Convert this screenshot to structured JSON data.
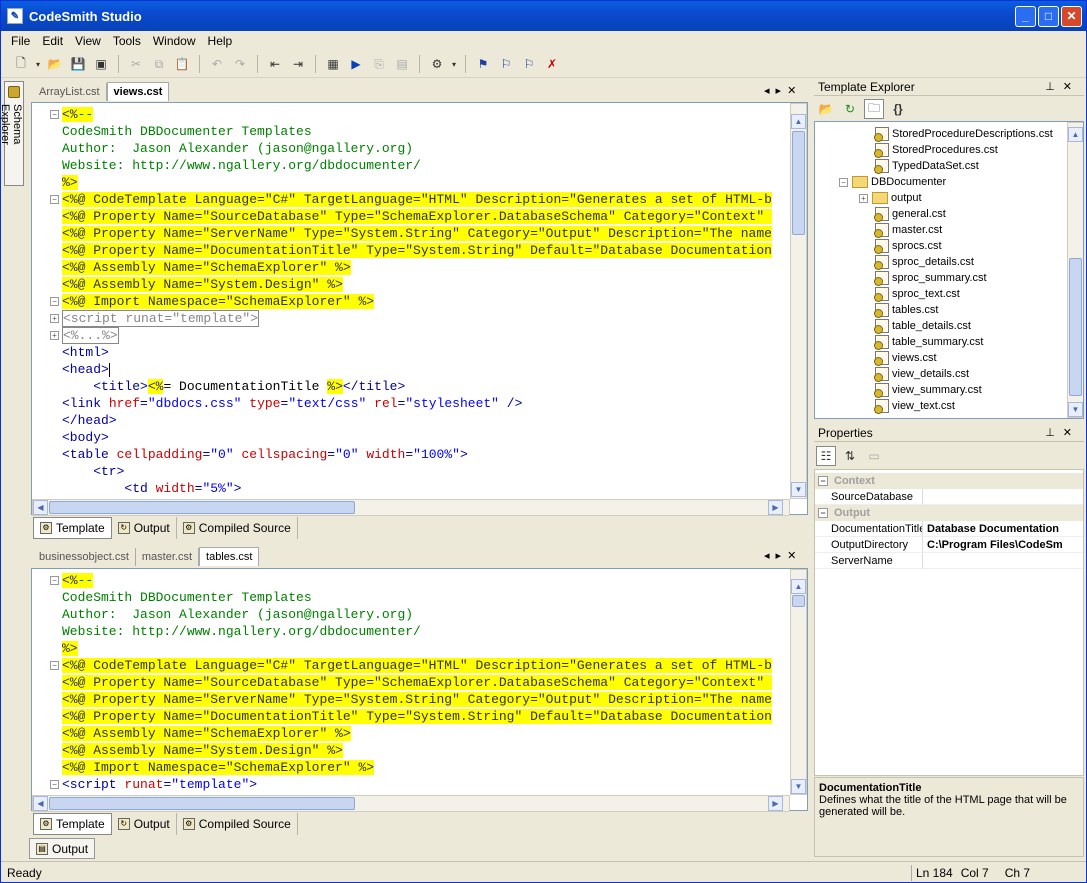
{
  "app": {
    "title": "CodeSmith Studio"
  },
  "menu": [
    "File",
    "Edit",
    "View",
    "Tools",
    "Window",
    "Help"
  ],
  "side_tab": {
    "label": "Schema Explorer"
  },
  "editor_top": {
    "tabs": [
      {
        "label": "ArrayList.cst",
        "active": false
      },
      {
        "label": "views.cst",
        "active": true
      }
    ],
    "lines": [
      {
        "fold": "-",
        "hl": true,
        "segs": [
          [
            "dir",
            "<%"
          ],
          [
            "com",
            "--"
          ]
        ]
      },
      {
        "fold": "",
        "hl": false,
        "segs": [
          [
            "com",
            "CodeSmith DBDocumenter Templates"
          ]
        ]
      },
      {
        "fold": "",
        "hl": false,
        "segs": [
          [
            "com",
            "Author:  Jason Alexander (jason@ngallery.org)"
          ]
        ]
      },
      {
        "fold": "",
        "hl": false,
        "segs": [
          [
            "com",
            "Website: http://www.ngallery.org/dbdocumenter/"
          ]
        ]
      },
      {
        "fold": "",
        "hl": true,
        "segs": [
          [
            "dir",
            "%>"
          ]
        ]
      },
      {
        "fold": "-",
        "hl": true,
        "segs": [
          [
            "dir",
            "<%@ CodeTemplate Language=\"C#\" TargetLanguage=\"HTML\" Description=\"Generates a set of HTML-b"
          ]
        ]
      },
      {
        "fold": "",
        "hl": true,
        "segs": [
          [
            "dir",
            "<%@ Property Name=\"SourceDatabase\" Type=\"SchemaExplorer.DatabaseSchema\" Category=\"Context\" "
          ]
        ]
      },
      {
        "fold": "",
        "hl": true,
        "segs": [
          [
            "dir",
            "<%@ Property Name=\"ServerName\" Type=\"System.String\" Category=\"Output\" Description=\"The name"
          ]
        ]
      },
      {
        "fold": "",
        "hl": true,
        "segs": [
          [
            "dir",
            "<%@ Property Name=\"DocumentationTitle\" Type=\"System.String\" Default=\"Database Documentation"
          ]
        ]
      },
      {
        "fold": "",
        "hl": true,
        "segs": [
          [
            "dir",
            "<%@ Assembly Name=\"SchemaExplorer\" %>"
          ]
        ]
      },
      {
        "fold": "",
        "hl": true,
        "segs": [
          [
            "dir",
            "<%@ Assembly Name=\"System.Design\" %>"
          ]
        ]
      },
      {
        "fold": "-",
        "hl": true,
        "segs": [
          [
            "dir",
            "<%@ Import Namespace=\"SchemaExplorer\" %>"
          ]
        ]
      },
      {
        "fold": "+",
        "hl": false,
        "segs": [
          [
            "box",
            "<script runat=\"template\">"
          ]
        ]
      },
      {
        "fold": "+",
        "hl": false,
        "segs": [
          [
            "box",
            "<%...%>"
          ]
        ]
      },
      {
        "fold": "",
        "hl": false,
        "segs": [
          [
            "tag",
            "<html>"
          ]
        ]
      },
      {
        "fold": "",
        "hl": false,
        "segs": [
          [
            "tag",
            "<head>"
          ]
        ]
      },
      {
        "fold": "",
        "hl": false,
        "segs": [
          [
            "tag",
            "    <title>"
          ],
          [
            "hldir",
            "<%"
          ],
          [
            "plain",
            "= DocumentationTitle "
          ],
          [
            "hldir",
            "%>"
          ],
          [
            "tag",
            "</title>"
          ]
        ]
      },
      {
        "fold": "",
        "hl": false,
        "segs": [
          [
            "tag",
            "<link "
          ],
          [
            "att",
            "href"
          ],
          [
            "tag",
            "="
          ],
          [
            "str",
            "\"dbdocs.css\""
          ],
          [
            "tag",
            " "
          ],
          [
            "att",
            "type"
          ],
          [
            "tag",
            "="
          ],
          [
            "str",
            "\"text/css\""
          ],
          [
            "tag",
            " "
          ],
          [
            "att",
            "rel"
          ],
          [
            "tag",
            "="
          ],
          [
            "str",
            "\"stylesheet\""
          ],
          [
            "tag",
            " />"
          ]
        ]
      },
      {
        "fold": "",
        "hl": false,
        "segs": [
          [
            "tag",
            "</head>"
          ]
        ]
      },
      {
        "fold": "",
        "hl": false,
        "segs": [
          [
            "tag",
            "<body>"
          ]
        ]
      },
      {
        "fold": "",
        "hl": false,
        "segs": [
          [
            "tag",
            "<table "
          ],
          [
            "att",
            "cellpadding"
          ],
          [
            "tag",
            "="
          ],
          [
            "str",
            "\"0\""
          ],
          [
            "tag",
            " "
          ],
          [
            "att",
            "cellspacing"
          ],
          [
            "tag",
            "="
          ],
          [
            "str",
            "\"0\""
          ],
          [
            "tag",
            " "
          ],
          [
            "att",
            "width"
          ],
          [
            "tag",
            "="
          ],
          [
            "str",
            "\"100%\""
          ],
          [
            "tag",
            ">"
          ]
        ]
      },
      {
        "fold": "",
        "hl": false,
        "segs": [
          [
            "tag",
            "    <tr>"
          ]
        ]
      },
      {
        "fold": "",
        "hl": false,
        "segs": [
          [
            "tag",
            "        <td "
          ],
          [
            "att",
            "width"
          ],
          [
            "tag",
            "="
          ],
          [
            "str",
            "\"5%\""
          ],
          [
            "tag",
            ">"
          ]
        ]
      }
    ]
  },
  "editor_bottom": {
    "tabs": [
      {
        "label": "businessobject.cst",
        "active": false
      },
      {
        "label": "master.cst",
        "active": false
      },
      {
        "label": "tables.cst",
        "active": true
      }
    ],
    "lines": [
      {
        "fold": "-",
        "hl": true,
        "segs": [
          [
            "dir",
            "<%"
          ],
          [
            "com",
            "--"
          ]
        ]
      },
      {
        "fold": "",
        "hl": false,
        "segs": [
          [
            "com",
            "CodeSmith DBDocumenter Templates"
          ]
        ]
      },
      {
        "fold": "",
        "hl": false,
        "segs": [
          [
            "com",
            "Author:  Jason Alexander (jason@ngallery.org)"
          ]
        ]
      },
      {
        "fold": "",
        "hl": false,
        "segs": [
          [
            "com",
            "Website: http://www.ngallery.org/dbdocumenter/"
          ]
        ]
      },
      {
        "fold": "",
        "hl": true,
        "segs": [
          [
            "dir",
            "%>"
          ]
        ]
      },
      {
        "fold": "-",
        "hl": true,
        "segs": [
          [
            "dir",
            "<%@ CodeTemplate Language=\"C#\" TargetLanguage=\"HTML\" Description=\"Generates a set of HTML-b"
          ]
        ]
      },
      {
        "fold": "",
        "hl": true,
        "segs": [
          [
            "dir",
            "<%@ Property Name=\"SourceDatabase\" Type=\"SchemaExplorer.DatabaseSchema\" Category=\"Context\" "
          ]
        ]
      },
      {
        "fold": "",
        "hl": true,
        "segs": [
          [
            "dir",
            "<%@ Property Name=\"ServerName\" Type=\"System.String\" Category=\"Output\" Description=\"The name"
          ]
        ]
      },
      {
        "fold": "",
        "hl": true,
        "segs": [
          [
            "dir",
            "<%@ Property Name=\"DocumentationTitle\" Type=\"System.String\" Default=\"Database Documentation"
          ]
        ]
      },
      {
        "fold": "",
        "hl": true,
        "segs": [
          [
            "dir",
            "<%@ Assembly Name=\"SchemaExplorer\" %>"
          ]
        ]
      },
      {
        "fold": "",
        "hl": true,
        "segs": [
          [
            "dir",
            "<%@ Assembly Name=\"System.Design\" %>"
          ]
        ]
      },
      {
        "fold": "",
        "hl": true,
        "segs": [
          [
            "dir",
            "<%@ Import Namespace=\"SchemaExplorer\" %>"
          ]
        ]
      },
      {
        "fold": "-",
        "hl": false,
        "segs": [
          [
            "tag",
            "<script "
          ],
          [
            "att",
            "runat"
          ],
          [
            "tag",
            "="
          ],
          [
            "str",
            "\"template\""
          ],
          [
            "tag",
            ">"
          ]
        ]
      }
    ]
  },
  "view_tabs": [
    "Template",
    "Output",
    "Compiled Source"
  ],
  "template_explorer": {
    "title": "Template Explorer",
    "nodes": [
      {
        "label": "StoredProcedureDescriptions.cst",
        "level": 2,
        "kind": "file"
      },
      {
        "label": "StoredProcedures.cst",
        "level": 2,
        "kind": "file"
      },
      {
        "label": "TypedDataSet.cst",
        "level": 2,
        "kind": "file"
      },
      {
        "label": "DBDocumenter",
        "level": 1,
        "kind": "folder",
        "exp": "-"
      },
      {
        "label": "output",
        "level": 2,
        "kind": "folder",
        "exp": "+"
      },
      {
        "label": "general.cst",
        "level": 2,
        "kind": "file"
      },
      {
        "label": "master.cst",
        "level": 2,
        "kind": "file"
      },
      {
        "label": "sprocs.cst",
        "level": 2,
        "kind": "file"
      },
      {
        "label": "sproc_details.cst",
        "level": 2,
        "kind": "file"
      },
      {
        "label": "sproc_summary.cst",
        "level": 2,
        "kind": "file"
      },
      {
        "label": "sproc_text.cst",
        "level": 2,
        "kind": "file"
      },
      {
        "label": "tables.cst",
        "level": 2,
        "kind": "file"
      },
      {
        "label": "table_details.cst",
        "level": 2,
        "kind": "file"
      },
      {
        "label": "table_summary.cst",
        "level": 2,
        "kind": "file"
      },
      {
        "label": "views.cst",
        "level": 2,
        "kind": "file"
      },
      {
        "label": "view_details.cst",
        "level": 2,
        "kind": "file"
      },
      {
        "label": "view_summary.cst",
        "level": 2,
        "kind": "file"
      },
      {
        "label": "view_text.cst",
        "level": 2,
        "kind": "file"
      }
    ]
  },
  "properties": {
    "title": "Properties",
    "rows": [
      {
        "cat": "Context"
      },
      {
        "name": "SourceDatabase",
        "value": ""
      },
      {
        "cat": "Output"
      },
      {
        "name": "DocumentationTitle",
        "value": "Database Documentation"
      },
      {
        "name": "OutputDirectory",
        "value": "C:\\Program Files\\CodeSm"
      },
      {
        "name": "ServerName",
        "value": ""
      }
    ],
    "desc_title": "DocumentationTitle",
    "desc_text": "Defines what the title of the HTML page that will be generated will be."
  },
  "output_tab": "Output",
  "status": {
    "text": "Ready",
    "ln": "Ln 184",
    "col": "Col 7",
    "ch": "Ch 7"
  }
}
